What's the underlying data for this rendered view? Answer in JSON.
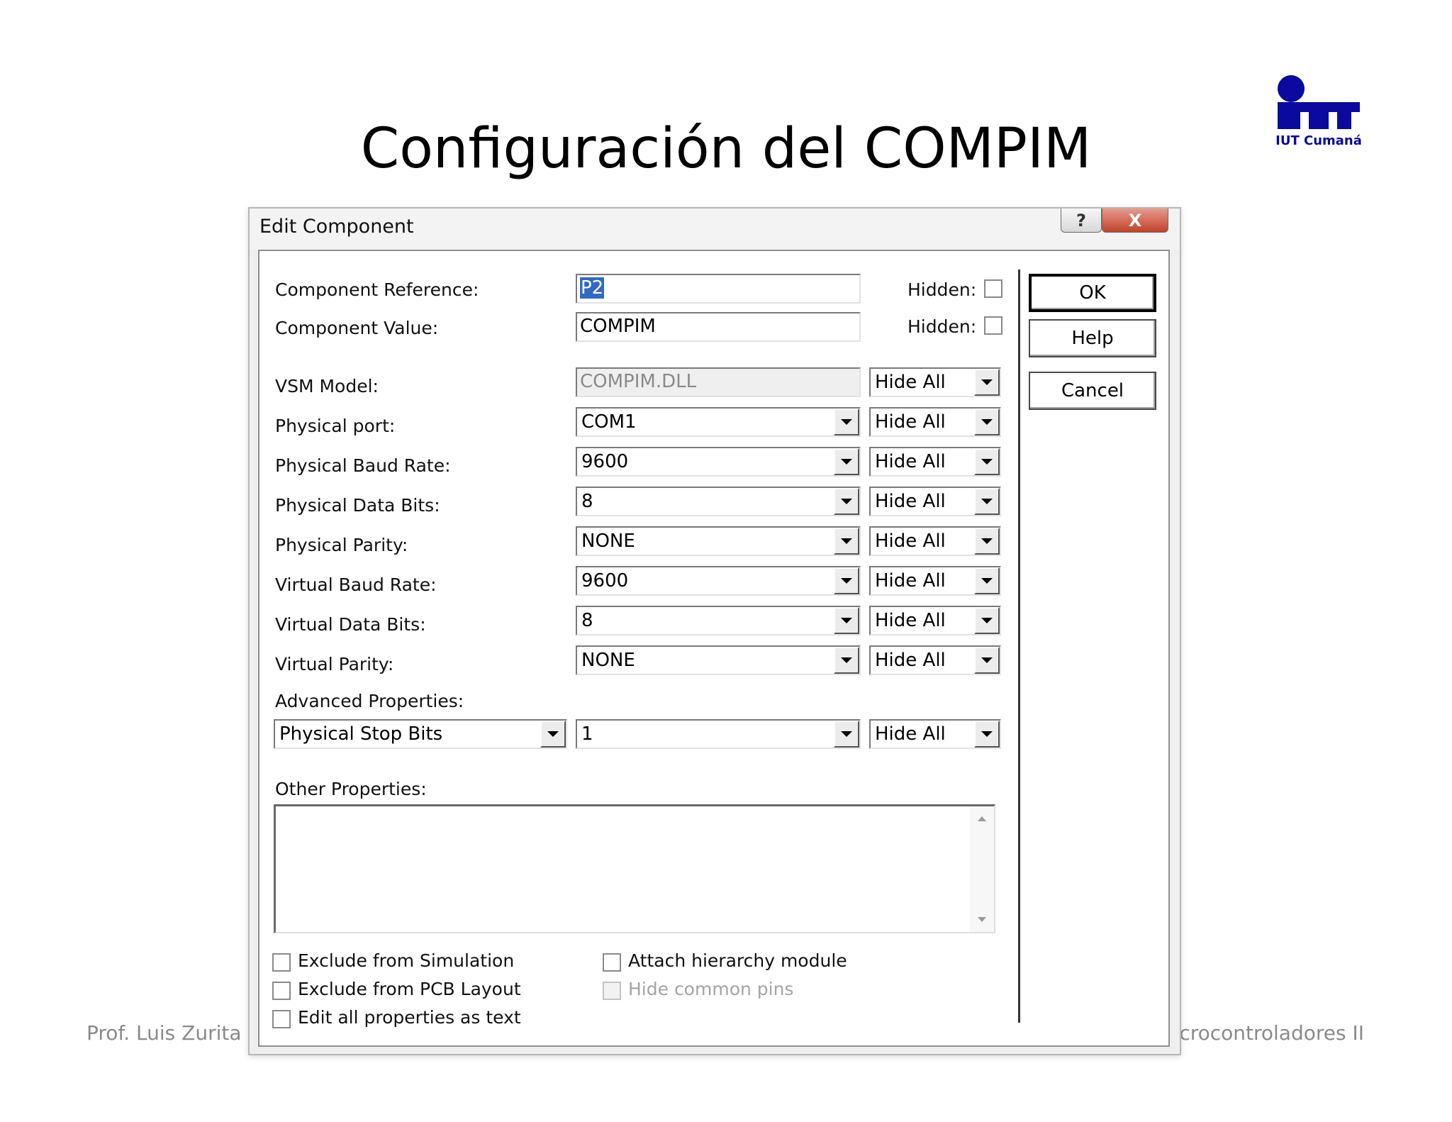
{
  "slide": {
    "title": "Configuración del COMPIM",
    "logo_text": "IUT Cumaná",
    "footer_left": "Prof. Luis Zurita",
    "footer_right": "Microcontroladores II"
  },
  "dialog": {
    "title": "Edit Component",
    "help_icon": "?",
    "close_icon": "X",
    "component_reference": {
      "label": "Component Reference:",
      "value": "P2",
      "hidden_label": "Hidden:",
      "hidden_checked": false
    },
    "component_value": {
      "label": "Component Value:",
      "value": "COMPIM",
      "hidden_label": "Hidden:",
      "hidden_checked": false
    },
    "vsm_model": {
      "label": "VSM Model:",
      "value": "COMPIM.DLL",
      "visibility": "Hide All"
    },
    "properties": [
      {
        "label": "Physical port:",
        "value": "COM1",
        "visibility": "Hide All"
      },
      {
        "label": "Physical Baud Rate:",
        "value": "9600",
        "visibility": "Hide All"
      },
      {
        "label": "Physical Data Bits:",
        "value": "8",
        "visibility": "Hide All"
      },
      {
        "label": "Physical Parity:",
        "value": "NONE",
        "visibility": "Hide All"
      },
      {
        "label": "Virtual Baud Rate:",
        "value": "9600",
        "visibility": "Hide All"
      },
      {
        "label": "Virtual Data Bits:",
        "value": "8",
        "visibility": "Hide All"
      },
      {
        "label": "Virtual Parity:",
        "value": "NONE",
        "visibility": "Hide All"
      }
    ],
    "advanced": {
      "label": "Advanced Properties:",
      "property": "Physical Stop Bits",
      "value": "1",
      "visibility": "Hide All"
    },
    "other_properties": {
      "label": "Other Properties:",
      "value": ""
    },
    "checkboxes": [
      {
        "label": "Exclude from Simulation",
        "checked": false,
        "enabled": true
      },
      {
        "label": "Exclude from PCB Layout",
        "checked": false,
        "enabled": true
      },
      {
        "label": "Edit all properties as text",
        "checked": false,
        "enabled": true
      },
      {
        "label": "Attach hierarchy module",
        "checked": false,
        "enabled": true
      },
      {
        "label": "Hide common pins",
        "checked": false,
        "enabled": false
      }
    ],
    "buttons": {
      "ok": "OK",
      "help": "Help",
      "cancel": "Cancel"
    }
  },
  "colors": {
    "logo": "#0a0a9e",
    "selection": "#316ac5",
    "close_button": "#c2412a"
  }
}
